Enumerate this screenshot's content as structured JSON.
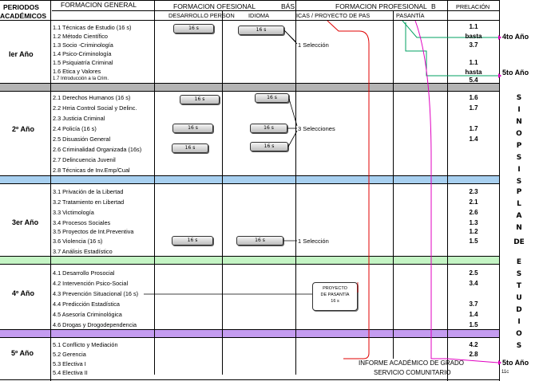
{
  "header": {
    "periodos": "PERIODOS",
    "academicos": "ACADÉMICOS",
    "formacion_general": "FORMACION GENERAL",
    "formacion_profesional_1": "FORMACION OFESIONAL",
    "bas": "BÁS",
    "formacion_profesional_2": "FORMACION PROFESIONAL",
    "b": "B",
    "prelacion": "PRELACIÓN",
    "desarrollo_personal": "DESARROLLO PERSON",
    "idioma": "IDIOMA",
    "practicas": "ICAS / PROYECTO DE PAS",
    "pasantia": "PASANTÍA"
  },
  "years": {
    "y1": "Ier Año",
    "y2": "2º Año",
    "y3": "3er Año",
    "y4": "4º Año",
    "y5": "5º Año"
  },
  "courses": {
    "c11": "1.1 Técnicas de Estudio  (16 s)",
    "c12": "1.2  Método Científico",
    "c13": "1.3 Socio -Criminología",
    "c14": "1.4 Psico-Criminología",
    "c15": "1.5 Psiquiatría Criminal",
    "c16": "1.6 Etica y Valores",
    "c17": "1.7 Introducción a la Crim.",
    "c21": "2.1 Derechos Humanos  (16 s)",
    "c22": "2.2 Hrria Control Social y Delinc.",
    "c23": "2.3 Justicia  Criminal",
    "c24": "2.4 Policía  (16 s)",
    "c25": "2.5 Disuasión General",
    "c26": "2.6 Criminalidad Organizada  (16s)",
    "c27": "2.7 Delincuencia Juvenil",
    "c28": "2.8 Técnicas de Inv.Emp/Cual",
    "c31": "3.1 Privación de la Libertad",
    "c32": "3.2 Tratamiento en Libertad",
    "c33": "3.3 Victimología",
    "c34": "3.4 Procesos Sociales",
    "c35": "3.5 Proyectos de Int.Preventiva",
    "c36": "3.6 Violencia  (16 s)",
    "c37": "3.7 Análisis Estadístico",
    "c41": "4.1 Desarrollo Prosocial",
    "c42": "4.2 Intervención Psico-Social",
    "c43": "4.3 Prevención Situacional  (16 s)",
    "c44": "4.4 Predicción Estadística",
    "c45": "4.5 Asesoría Criminológica",
    "c46": "4.6 Drogas y Drogodependencia",
    "c51": "5.1 Conflicto y Mediación",
    "c52": "5.2 Gerencia",
    "c53": "5.3 Electiva I",
    "c54": "5.4 Electiva II"
  },
  "pill_label": "16 s",
  "selections": {
    "one": "1 Selección",
    "three": "3 Selecciones"
  },
  "proyecto_box": {
    "l1": "PROYECTO",
    "l2": "DE PASANTÍA",
    "l3": "16 s"
  },
  "prelacion": {
    "p11": "1.1",
    "p12": "basta",
    "p13": "3.7",
    "p15": "1.1",
    "p16": "hasta",
    "p17": "5.4",
    "p21": "1.6",
    "p22": "1.7",
    "p24": "1.7",
    "p25": "1.4",
    "p31": "2.3",
    "p32": "2.1",
    "p33": "2.6",
    "p34": "1.3",
    "p35": "1.2",
    "p36": "1.5",
    "p41": "2.5",
    "p42": "3.4",
    "p44": "3.7",
    "p45": "1.4",
    "p46": "1.5",
    "p51": "4.2",
    "p52": "2.8"
  },
  "side_labels": {
    "a1": "4to Año",
    "a2": "5to Año",
    "a3": "5to Año",
    "c11": "11c",
    "letters": [
      "S",
      "I",
      "N",
      "O",
      "P",
      "S",
      "I",
      "S",
      "P",
      "L",
      "A",
      "N",
      "DE",
      "E",
      "S",
      "T",
      "U",
      "D",
      "I",
      "O",
      "S",
      "S"
    ]
  },
  "footer": {
    "informe": "INFORME ACADÉMICO DE GRADO",
    "servicio": "SERVICIO COMUNITARIO"
  },
  "colors": {
    "gray_band": "#b4b4b4",
    "blue_band": "#a8d0f0",
    "green_band": "#c4f4c4",
    "purple_band": "#c49cf0",
    "red_line": "#e00000",
    "green_line": "#00a060",
    "magenta_line": "#e000c0"
  }
}
